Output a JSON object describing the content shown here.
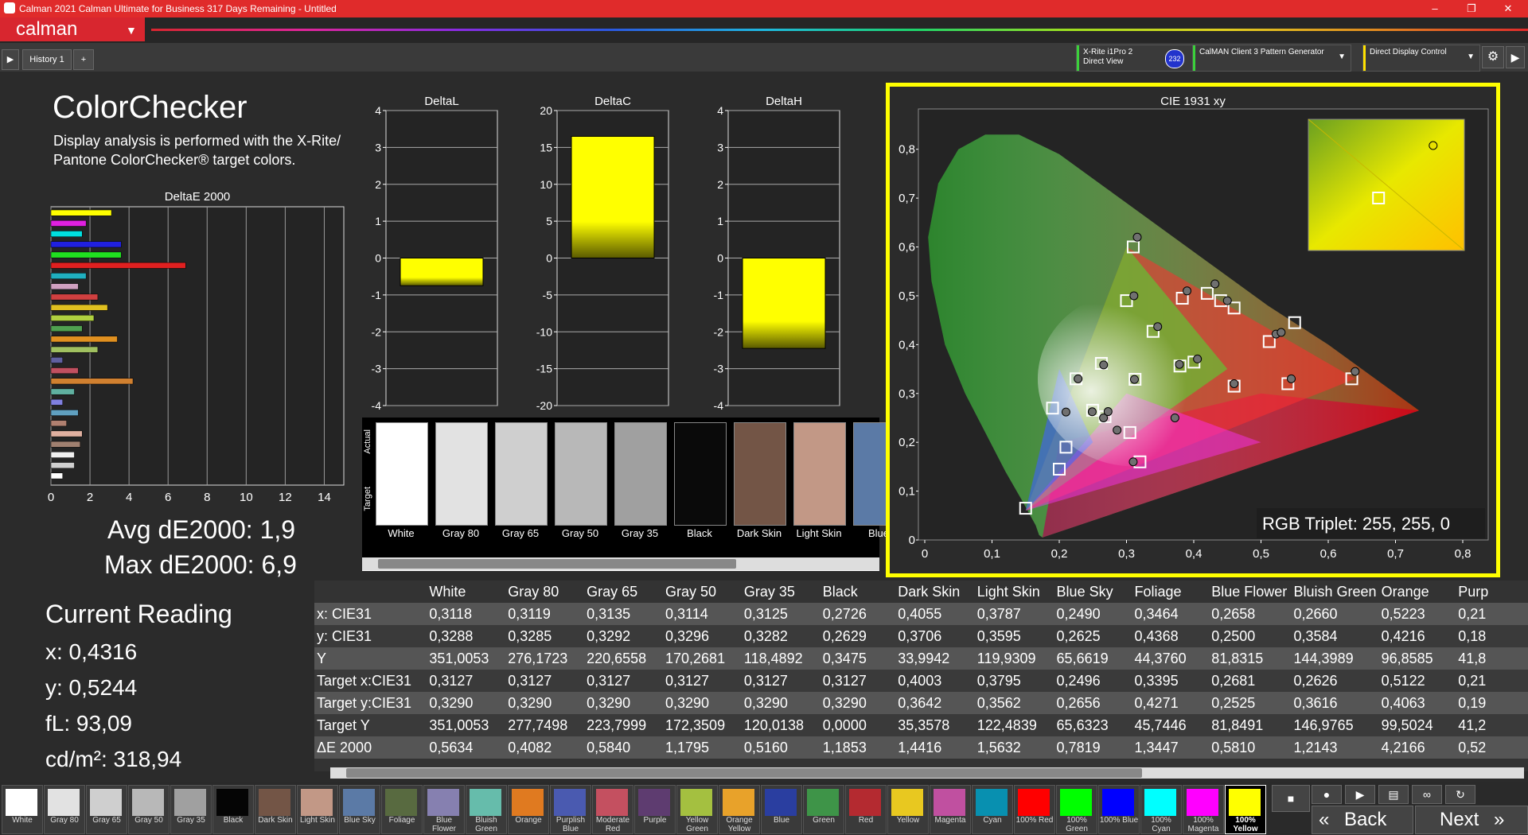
{
  "window": {
    "title": "Calman 2021 Calman Ultimate for Business 317 Days Remaining  -  Untitled",
    "minimize": "–",
    "maximize": "❐",
    "close": "✕"
  },
  "brand": {
    "name": "calman"
  },
  "tabs": {
    "history": "History 1",
    "add": "+"
  },
  "devices": {
    "meter": "X-Rite i1Pro 2\nDirect View",
    "meter_badge": "232",
    "generator": "CalMAN Client 3 Pattern Generator",
    "display": "Direct Display Control"
  },
  "colors": {
    "accent_red": "#d8262f",
    "highlight_yellow": "#ffff00",
    "meter_green": "#3bd13b",
    "display_yellow": "#ffe100"
  },
  "left": {
    "title": "ColorChecker",
    "desc1": "Display analysis is performed with the X-Rite/",
    "desc2": "Pantone ColorChecker® target colors.",
    "deltae_title": "DeltaE 2000",
    "avg": "Avg dE2000: 1,9",
    "max": "Max dE2000: 6,9",
    "current_title": "Current Reading",
    "x": "x: 0,4316",
    "y": "y: 0,5244",
    "fl": "fL: 93,09",
    "cd": "cd/m²: 318,94"
  },
  "chart_data": [
    {
      "type": "bar",
      "title": "DeltaE 2000",
      "orientation": "horizontal",
      "xlim": [
        0,
        15
      ],
      "xticks": [
        "0",
        "2",
        "4",
        "6",
        "8",
        "10",
        "12",
        "14"
      ],
      "values": [
        3.1,
        1.8,
        1.6,
        3.6,
        3.6,
        6.9,
        1.8,
        1.4,
        2.4,
        2.9,
        2.2,
        1.6,
        3.4,
        2.4,
        0.6,
        1.4,
        4.2,
        1.2,
        0.6,
        1.4,
        0.8,
        1.6,
        1.5,
        1.2,
        1.2,
        0.6
      ],
      "colors": [
        "#ffff00",
        "#e020e0",
        "#00e0e0",
        "#2020e0",
        "#20e020",
        "#e02020",
        "#20b0c0",
        "#d0a0c0",
        "#d04040",
        "#e0c020",
        "#b0d040",
        "#50a050",
        "#e09020",
        "#a0c060",
        "#6060a0",
        "#c05060",
        "#d08030",
        "#60b0a0",
        "#8080e0",
        "#60a0c0",
        "#b08070",
        "#e0b0a0",
        "#a08070",
        "#f0f0f0",
        "#d0d0d0",
        "#ffffff"
      ]
    },
    {
      "type": "bar",
      "title": "DeltaL",
      "ylim": [
        -4,
        4
      ],
      "yticks": [
        "4",
        "3",
        "2",
        "1",
        "0",
        "-1",
        "-2",
        "-3",
        "-4"
      ],
      "values": [
        -0.75
      ]
    },
    {
      "type": "bar",
      "title": "DeltaC",
      "ylim": [
        -20,
        20
      ],
      "yticks": [
        "20",
        "15",
        "10",
        "5",
        "0",
        "-5",
        "-10",
        "-15",
        "-20"
      ],
      "values": [
        16.5
      ]
    },
    {
      "type": "bar",
      "title": "DeltaH",
      "ylim": [
        -4,
        4
      ],
      "yticks": [
        "4",
        "3",
        "2",
        "1",
        "0",
        "-1",
        "-2",
        "-3",
        "-4"
      ],
      "values": [
        -2.45
      ]
    },
    {
      "type": "scatter",
      "title": "CIE 1931 xy",
      "xlim": [
        0,
        0.8
      ],
      "ylim": [
        0,
        0.85
      ],
      "xticks": [
        "0",
        "0,1",
        "0,2",
        "0,3",
        "0,4",
        "0,5",
        "0,6",
        "0,7",
        "0,8"
      ],
      "yticks": [
        "0",
        "0,1",
        "0,2",
        "0,3",
        "0,4",
        "0,5",
        "0,6",
        "0,7",
        "0,8"
      ],
      "gamut": {
        "red": [
          0.64,
          0.33
        ],
        "green": [
          0.3,
          0.6
        ],
        "blue": [
          0.15,
          0.06
        ]
      },
      "targets": [
        [
          0.3127,
          0.329
        ],
        [
          0.4003,
          0.3642
        ],
        [
          0.3795,
          0.3562
        ],
        [
          0.2496,
          0.2656
        ],
        [
          0.3395,
          0.4271
        ],
        [
          0.2681,
          0.2525
        ],
        [
          0.2626,
          0.3616
        ],
        [
          0.5122,
          0.4063
        ],
        [
          0.21,
          0.19
        ],
        [
          0.46,
          0.315
        ],
        [
          0.2,
          0.145
        ],
        [
          0.3,
          0.49
        ],
        [
          0.46,
          0.475
        ],
        [
          0.225,
          0.33
        ],
        [
          0.42,
          0.505
        ],
        [
          0.383,
          0.495
        ],
        [
          0.305,
          0.22
        ],
        [
          0.635,
          0.33
        ],
        [
          0.54,
          0.32
        ],
        [
          0.19,
          0.27
        ],
        [
          0.32,
          0.16
        ],
        [
          0.15,
          0.065
        ],
        [
          0.31,
          0.6
        ],
        [
          0.55,
          0.445
        ],
        [
          0.44,
          0.49
        ]
      ],
      "measured": [
        [
          0.3118,
          0.3288
        ],
        [
          0.4055,
          0.3706
        ],
        [
          0.3787,
          0.3595
        ],
        [
          0.249,
          0.2625
        ],
        [
          0.3464,
          0.4368
        ],
        [
          0.2658,
          0.25
        ],
        [
          0.266,
          0.3584
        ],
        [
          0.5223,
          0.4216
        ],
        [
          0.2726,
          0.2629
        ],
        [
          0.46,
          0.32
        ],
        [
          0.53,
          0.425
        ],
        [
          0.45,
          0.49
        ],
        [
          0.4316,
          0.5244
        ],
        [
          0.39,
          0.51
        ],
        [
          0.316,
          0.62
        ],
        [
          0.311,
          0.5
        ],
        [
          0.21,
          0.262
        ],
        [
          0.286,
          0.225
        ],
        [
          0.64,
          0.345
        ],
        [
          0.545,
          0.33
        ],
        [
          0.31,
          0.16
        ],
        [
          0.228,
          0.33
        ],
        [
          0.372,
          0.25
        ]
      ],
      "inset_target": [
        0.69,
        0.67
      ],
      "inset_measured": [
        0.76,
        0.79
      ],
      "annotation": "RGB Triplet: 255, 255, 0"
    }
  ],
  "patches": [
    {
      "label": "White",
      "color": "#ffffff"
    },
    {
      "label": "Gray 80",
      "color": "#e2e2e2"
    },
    {
      "label": "Gray 65",
      "color": "#cfcfcf"
    },
    {
      "label": "Gray 50",
      "color": "#b8b8b8"
    },
    {
      "label": "Gray 35",
      "color": "#a0a0a0"
    },
    {
      "label": "Black",
      "color": "#0a0a0a"
    },
    {
      "label": "Dark Skin",
      "color": "#735546"
    },
    {
      "label": "Light Skin",
      "color": "#c29886"
    },
    {
      "label": "Blue",
      "color": "#5b7aa6"
    }
  ],
  "patch_side": {
    "actual": "Actual",
    "target": "Target"
  },
  "table": {
    "headers": [
      "",
      "White",
      "Gray 80",
      "Gray 65",
      "Gray 50",
      "Gray 35",
      "Black",
      "Dark Skin",
      "Light Skin",
      "Blue Sky",
      "Foliage",
      "Blue Flower",
      "Bluish Green",
      "Orange",
      "Purp"
    ],
    "rows": [
      [
        "x: CIE31",
        "0,3118",
        "0,3119",
        "0,3135",
        "0,3114",
        "0,3125",
        "0,2726",
        "0,4055",
        "0,3787",
        "0,2490",
        "0,3464",
        "0,2658",
        "0,2660",
        "0,5223",
        "0,21"
      ],
      [
        "y: CIE31",
        "0,3288",
        "0,3285",
        "0,3292",
        "0,3296",
        "0,3282",
        "0,2629",
        "0,3706",
        "0,3595",
        "0,2625",
        "0,4368",
        "0,2500",
        "0,3584",
        "0,4216",
        "0,18"
      ],
      [
        "Y",
        "351,0053",
        "276,1723",
        "220,6558",
        "170,2681",
        "118,4892",
        "0,3475",
        "33,9942",
        "119,9309",
        "65,6619",
        "44,3760",
        "81,8315",
        "144,3989",
        "96,8585",
        "41,8"
      ],
      [
        "Target x:CIE31",
        "0,3127",
        "0,3127",
        "0,3127",
        "0,3127",
        "0,3127",
        "0,3127",
        "0,4003",
        "0,3795",
        "0,2496",
        "0,3395",
        "0,2681",
        "0,2626",
        "0,5122",
        "0,21"
      ],
      [
        "Target y:CIE31",
        "0,3290",
        "0,3290",
        "0,3290",
        "0,3290",
        "0,3290",
        "0,3290",
        "0,3642",
        "0,3562",
        "0,2656",
        "0,4271",
        "0,2525",
        "0,3616",
        "0,4063",
        "0,19"
      ],
      [
        "Target Y",
        "351,0053",
        "277,7498",
        "223,7999",
        "172,3509",
        "120,0138",
        "0,0000",
        "35,3578",
        "122,4839",
        "65,6323",
        "45,7446",
        "81,8491",
        "146,9765",
        "99,5024",
        "41,2"
      ],
      [
        "ΔE 2000",
        "0,5634",
        "0,4082",
        "0,5840",
        "1,1795",
        "0,5160",
        "1,1853",
        "1,4416",
        "1,5632",
        "0,7819",
        "1,3447",
        "0,5810",
        "1,2143",
        "4,2166",
        "0,52"
      ]
    ]
  },
  "swatches": [
    {
      "label": "White",
      "color": "#ffffff"
    },
    {
      "label": "Gray 80",
      "color": "#e2e2e2"
    },
    {
      "label": "Gray 65",
      "color": "#cfcfcf"
    },
    {
      "label": "Gray 50",
      "color": "#b8b8b8"
    },
    {
      "label": "Gray 35",
      "color": "#a0a0a0"
    },
    {
      "label": "Black",
      "color": "#050505"
    },
    {
      "label": "Dark Skin",
      "color": "#735546"
    },
    {
      "label": "Light Skin",
      "color": "#c29886"
    },
    {
      "label": "Blue Sky",
      "color": "#5b7aa6"
    },
    {
      "label": "Foliage",
      "color": "#586a40"
    },
    {
      "label": "Blue Flower",
      "color": "#8680b0"
    },
    {
      "label": "Bluish Green",
      "color": "#66bcab"
    },
    {
      "label": "Orange",
      "color": "#e07a20"
    },
    {
      "label": "Purplish Blue",
      "color": "#4a5ab0"
    },
    {
      "label": "Moderate Red",
      "color": "#c45060"
    },
    {
      "label": "Purple",
      "color": "#5e3c70"
    },
    {
      "label": "Yellow Green",
      "color": "#a4c040"
    },
    {
      "label": "Orange Yellow",
      "color": "#e8a22a"
    },
    {
      "label": "Blue",
      "color": "#2a3ea0"
    },
    {
      "label": "Green",
      "color": "#3e9448"
    },
    {
      "label": "Red",
      "color": "#b42a30"
    },
    {
      "label": "Yellow",
      "color": "#e8c820"
    },
    {
      "label": "Magenta",
      "color": "#c050a0"
    },
    {
      "label": "Cyan",
      "color": "#0890b0"
    },
    {
      "label": "100% Red",
      "color": "#ff0000"
    },
    {
      "label": "100% Green",
      "color": "#00ff00"
    },
    {
      "label": "100% Blue",
      "color": "#0000ff"
    },
    {
      "label": "100% Cyan",
      "color": "#00ffff"
    },
    {
      "label": "100% Magenta",
      "color": "#ff00ff"
    },
    {
      "label": "100% Yellow",
      "color": "#ffff00"
    }
  ],
  "nav": {
    "back": "Back",
    "next": "Next"
  }
}
